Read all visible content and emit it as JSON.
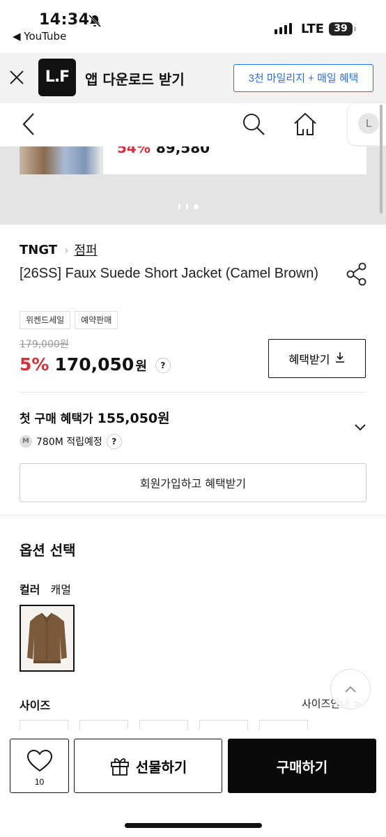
{
  "status_bar": {
    "time": "14:34",
    "back_app": "◀ YouTube",
    "network": "LTE",
    "battery": "39"
  },
  "app_banner": {
    "logo_text": "L.F",
    "title": "앱 다운로드 받기",
    "promo_button": "3천 마일리지 + 매일 혜택"
  },
  "nav": {
    "profile_initial": "L"
  },
  "carousel": {
    "card_discount": "54%",
    "card_price": "89,580",
    "slide_count": 3,
    "active_slide": 3
  },
  "product": {
    "brand": "TNGT",
    "category": "점퍼",
    "name": "[26SS] Faux Suede Short Jacket (Camel Brown)",
    "tags": [
      "위켄드세일",
      "예약판매"
    ],
    "original_price": "179,000원",
    "discount_rate": "5%",
    "price": "170,050",
    "price_unit": "원",
    "help_mark": "?",
    "benefit_button": "혜택받기"
  },
  "first_purchase": {
    "label": "첫 구매 혜택가",
    "amount": "155,050원",
    "mileage_badge": "M",
    "mileage_text": "780M 적립예정",
    "help_mark": "?",
    "signup_button": "회원가입하고 혜택받기"
  },
  "options": {
    "title": "옵션 선택",
    "color_label": "컬러",
    "color_value": "캐멀",
    "size_label": "사이즈",
    "size_guide": "사이즈안내 >"
  },
  "bottom_bar": {
    "like_count": "10",
    "gift_button": "선물하기",
    "buy_button": "구매하기"
  },
  "colors": {
    "sale_red": "#d4313c",
    "link_blue": "#2f6fd6",
    "buy_black": "#0a0a0a",
    "jacket_camel": "#7a5a3a"
  }
}
